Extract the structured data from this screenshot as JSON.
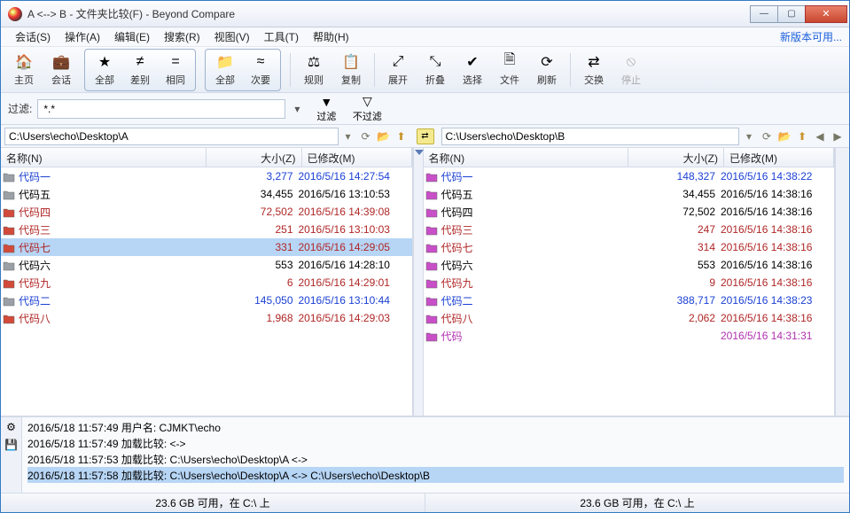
{
  "window": {
    "title": "A <--> B - 文件夹比较(F) - Beyond Compare"
  },
  "menu": {
    "items": [
      "会话(S)",
      "操作(A)",
      "编辑(E)",
      "搜索(R)",
      "视图(V)",
      "工具(T)",
      "帮助(H)"
    ],
    "right_link": "新版本可用..."
  },
  "toolbar": {
    "home": "主页",
    "session": "会话",
    "all": "全部",
    "diff": "差别",
    "same": "相同",
    "all2": "全部",
    "minor": "次要",
    "rules": "规则",
    "copy": "复制",
    "expand": "展开",
    "collapse": "折叠",
    "select": "选择",
    "files": "文件",
    "refresh": "刷新",
    "swap": "交换",
    "stop": "停止"
  },
  "filter": {
    "label": "过滤:",
    "value": "*.*",
    "filter_btn": "过滤",
    "nofilter_btn": "不过滤"
  },
  "paths": {
    "left": "C:\\Users\\echo\\Desktop\\A",
    "right": "C:\\Users\\echo\\Desktop\\B"
  },
  "columns": {
    "name": "名称(N)",
    "size": "大小(Z)",
    "modified": "已修改(M)"
  },
  "left_rows": [
    {
      "name": "代码一",
      "size": "3,277",
      "date": "2016/5/16 14:27:54",
      "c": "blue",
      "f": "gray"
    },
    {
      "name": "代码五",
      "size": "34,455",
      "date": "2016/5/16 13:10:53",
      "c": "black",
      "f": "gray"
    },
    {
      "name": "代码四",
      "size": "72,502",
      "date": "2016/5/16 14:39:08",
      "c": "red",
      "f": "red"
    },
    {
      "name": "代码三",
      "size": "251",
      "date": "2016/5/16 13:10:03",
      "c": "red",
      "f": "red"
    },
    {
      "name": "代码七",
      "size": "331",
      "date": "2016/5/16 14:29:05",
      "c": "red",
      "f": "red",
      "sel": true
    },
    {
      "name": "代码六",
      "size": "553",
      "date": "2016/5/16 14:28:10",
      "c": "black",
      "f": "gray"
    },
    {
      "name": "代码九",
      "size": "6",
      "date": "2016/5/16 14:29:01",
      "c": "red",
      "f": "red"
    },
    {
      "name": "代码二",
      "size": "145,050",
      "date": "2016/5/16 13:10:44",
      "c": "blue",
      "f": "gray"
    },
    {
      "name": "代码八",
      "size": "1,968",
      "date": "2016/5/16 14:29:03",
      "c": "red",
      "f": "red"
    }
  ],
  "right_rows": [
    {
      "name": "代码一",
      "size": "148,327",
      "date": "2016/5/16 14:38:22",
      "c": "blue",
      "f": "mag"
    },
    {
      "name": "代码五",
      "size": "34,455",
      "date": "2016/5/16 14:38:16",
      "c": "black",
      "f": "mag"
    },
    {
      "name": "代码四",
      "size": "72,502",
      "date": "2016/5/16 14:38:16",
      "c": "black",
      "f": "mag"
    },
    {
      "name": "代码三",
      "size": "247",
      "date": "2016/5/16 14:38:16",
      "c": "red",
      "f": "mag"
    },
    {
      "name": "代码七",
      "size": "314",
      "date": "2016/5/16 14:38:16",
      "c": "red",
      "f": "mag"
    },
    {
      "name": "代码六",
      "size": "553",
      "date": "2016/5/16 14:38:16",
      "c": "black",
      "f": "mag"
    },
    {
      "name": "代码九",
      "size": "9",
      "date": "2016/5/16 14:38:16",
      "c": "red",
      "f": "mag"
    },
    {
      "name": "代码二",
      "size": "388,717",
      "date": "2016/5/16 14:38:23",
      "c": "blue",
      "f": "mag"
    },
    {
      "name": "代码八",
      "size": "2,062",
      "date": "2016/5/16 14:38:16",
      "c": "red",
      "f": "mag"
    },
    {
      "name": "代码",
      "size": "",
      "date": "2016/5/16 14:31:31",
      "c": "mag",
      "f": "mag"
    }
  ],
  "log": [
    {
      "t": "2016/5/18 11:57:49  用户名: CJMKT\\echo"
    },
    {
      "t": "2016/5/18 11:57:49  加载比较:  <->"
    },
    {
      "t": "2016/5/18 11:57:53  加载比较: C:\\Users\\echo\\Desktop\\A  <->"
    },
    {
      "t": "2016/5/18 11:57:58  加载比较: C:\\Users\\echo\\Desktop\\A  <->  C:\\Users\\echo\\Desktop\\B",
      "sel": true
    }
  ],
  "status": {
    "left": "23.6 GB 可用，在 C:\\ 上",
    "right": "23.6 GB 可用，在 C:\\ 上"
  },
  "icons": {
    "home": "🏠",
    "session": "💼",
    "all": "★",
    "diff": "≠",
    "same": "=",
    "all2": "📁",
    "minor": "≈",
    "rules": "⚖",
    "copy": "📋",
    "expand": "⤢",
    "collapse": "⤡",
    "select": "✔",
    "files": "🗎",
    "refresh": "⟳",
    "swap": "⇄",
    "stop": "⦸",
    "filter": "▼",
    "nofilter": "▽",
    "dd": "▾",
    "open": "📂",
    "up": "⬆",
    "back": "◀",
    "fwd": "▶",
    "gear": "⚙",
    "save": "💾"
  }
}
